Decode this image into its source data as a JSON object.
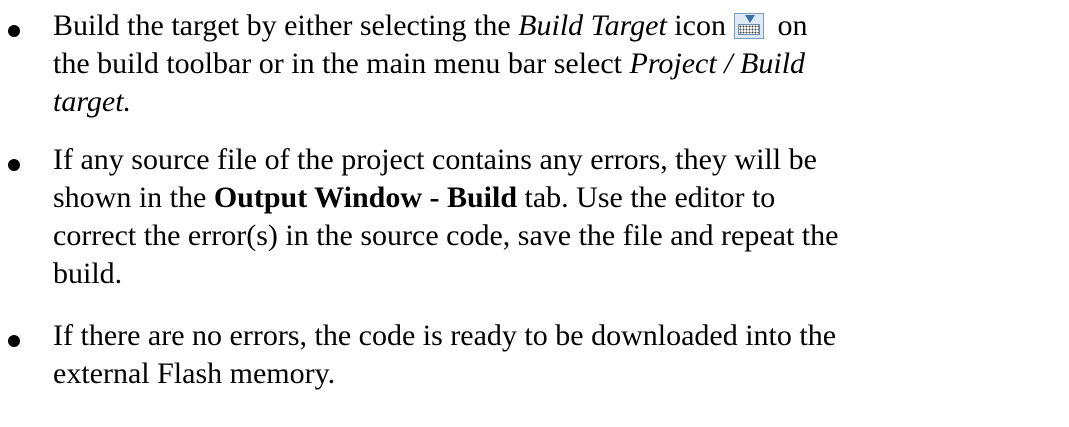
{
  "bullets": [
    {
      "line1_pre": "Build the target by either selecting the ",
      "line1_em": "Build Target",
      "line1_mid": " icon",
      "line1_post": " on",
      "line2_pre": "the build toolbar or in the main menu bar select ",
      "line2_em": "Project / Build",
      "line3_em": "target."
    },
    {
      "line1": "If any source file of the project contains any errors, they will be",
      "line2_pre": "shown in the ",
      "line2_bold": "Output Window - Build",
      "line2_post": " tab. Use the editor to",
      "line3": "correct the error(s) in the source code, save the file and repeat the",
      "line4": "build."
    },
    {
      "line1": "If there are no errors, the code is ready to be downloaded into the",
      "line2": "external Flash memory."
    }
  ],
  "icons": {
    "build_target": "build-target-icon"
  }
}
